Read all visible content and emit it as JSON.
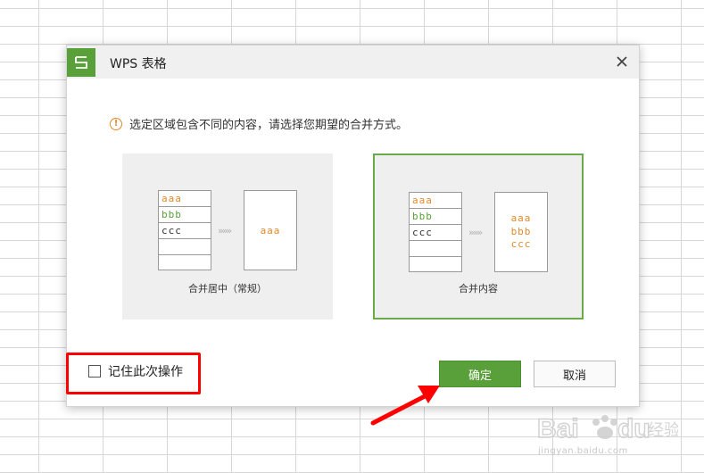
{
  "dialog": {
    "title": "WPS 表格",
    "message": "选定区域包含不同的内容，请选择您期望的合并方式。",
    "options": [
      {
        "label": "合并居中（常规）",
        "source_cells": [
          "aaa",
          "bbb",
          "ccc"
        ],
        "result_cells": [
          "aaa"
        ],
        "selected": false
      },
      {
        "label": "合并内容",
        "source_cells": [
          "aaa",
          "bbb",
          "ccc"
        ],
        "result_cells": [
          "aaa",
          "bbb",
          "ccc"
        ],
        "selected": true
      }
    ],
    "arrows": "»»»",
    "remember_label": "记住此次操作",
    "ok_label": "确定",
    "cancel_label": "取消"
  },
  "watermark": {
    "brand": "Baidu 经验",
    "url": "jingyan.baidu.com"
  },
  "colors": {
    "accent_green": "#5aa03a",
    "orange": "#e08a2c",
    "annotation_red": "#ff0000"
  }
}
